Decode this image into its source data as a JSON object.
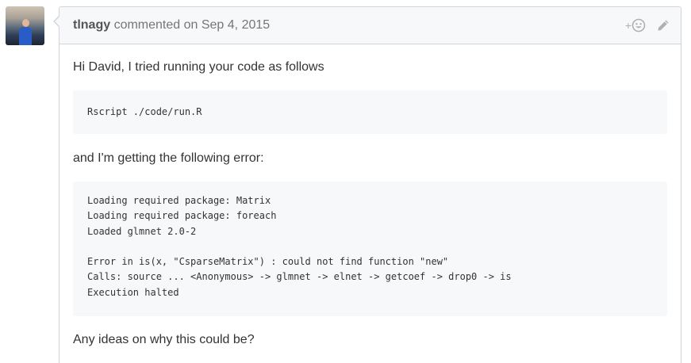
{
  "comment": {
    "author": "tlnagy",
    "action": "commented on Sep 4, 2015",
    "reaction_plus": "+",
    "paragraphs": [
      "Hi David, I tried running your code as follows",
      "and I'm getting the following error:",
      "Any ideas on why this could be?"
    ],
    "code_block_1": "Rscript ./code/run.R",
    "code_block_2": [
      "Loading required package: Matrix",
      "Loading required package: foreach",
      "Loaded glmnet 2.0-2",
      "",
      "Error in is(x, \"CsparseMatrix\") : could not find function \"new\"",
      "Calls: source ... <Anonymous> -> glmnet -> elnet -> getcoef -> drop0 -> is",
      "Execution halted"
    ]
  },
  "icons": {
    "avatar": "user-avatar",
    "reaction": "smiley-reaction-icon",
    "edit": "pencil-icon"
  },
  "colors": {
    "header_bg": "#f6f8fa",
    "border": "#d1d5da",
    "code_bg": "#f6f8fa",
    "muted_text": "#767676"
  }
}
